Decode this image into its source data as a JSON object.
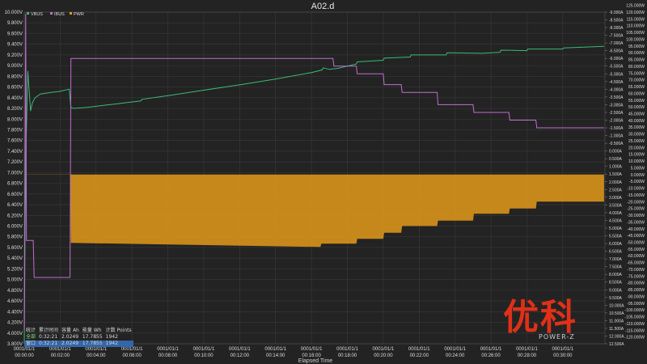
{
  "chart_data": {
    "type": "line",
    "title": "A02.d",
    "xlabel": "Elapsed Time",
    "x_ticks": [
      [
        "0001/01/1",
        "00:00:00"
      ],
      [
        "0001/01/1",
        "00:02:00"
      ],
      [
        "0001/01/1",
        "00:04:00"
      ],
      [
        "0001/01/1",
        "00:06:00"
      ],
      [
        "0001/01/1",
        "00:08:00"
      ],
      [
        "0001/01/1",
        "00:10:00"
      ],
      [
        "0001/01/1",
        "00:12:00"
      ],
      [
        "0001/01/1",
        "00:14:00"
      ],
      [
        "0001/01/1",
        "00:16:00"
      ],
      [
        "0001/01/1",
        "00:18:00"
      ],
      [
        "0001/01/1",
        "00:20:00"
      ],
      [
        "0001/01/1",
        "00:22:00"
      ],
      [
        "0001/01/1",
        "00:24:00"
      ],
      [
        "0001/01/1",
        "00:26:00"
      ],
      [
        "0001/01/1",
        "00:28:00"
      ],
      [
        "0001/01/1",
        "00:30:00"
      ]
    ],
    "xlim": [
      0,
      32.35
    ],
    "grid": true,
    "legend": "top-left",
    "axes": {
      "voltage": {
        "ylim": [
          3.8,
          10.0
        ],
        "ticks": [
          "3.800V",
          "4.000V",
          "4.200V",
          "4.400V",
          "4.600V",
          "4.800V",
          "5.000V",
          "5.200V",
          "5.400V",
          "5.600V",
          "5.800V",
          "6.000V",
          "6.200V",
          "6.400V",
          "6.600V",
          "6.800V",
          "7.000V",
          "7.200V",
          "7.400V",
          "7.600V",
          "7.800V",
          "8.000V",
          "8.200V",
          "8.400V",
          "8.600V",
          "8.800V",
          "9.000V",
          "9.200V",
          "9.400V",
          "9.600V",
          "9.800V",
          "10.000V"
        ]
      },
      "current": {
        "ylim": [
          12.5,
          -9.0
        ],
        "reversed": true,
        "ticks": [
          "-9.000A",
          "-8.500A",
          "-8.000A",
          "-7.500A",
          "-7.000A",
          "-6.500A",
          "-6.000A",
          "-5.500A",
          "-5.000A",
          "-4.500A",
          "-4.000A",
          "-3.500A",
          "-3.000A",
          "-2.500A",
          "-2.000A",
          "-1.500A",
          "-1.000A",
          "-0.500A",
          "0.000A",
          "0.500A",
          "1.000A",
          "1.500A",
          "2.000A",
          "2.500A",
          "3.000A",
          "3.500A",
          "4.000A",
          "4.500A",
          "5.000A",
          "5.500A",
          "6.000A",
          "6.500A",
          "7.000A",
          "7.500A",
          "8.000A",
          "8.500A",
          "9.000A",
          "9.500A",
          "10.000A",
          "10.500A",
          "11.000A",
          "11.500A",
          "12.000A",
          "12.500A"
        ]
      },
      "power": {
        "ylim": [
          -125,
          120
        ],
        "reversed": true,
        "ticks": [
          "-120.000W",
          "-115.000W",
          "-110.000W",
          "-105.000W",
          "-100.000W",
          "-95.000W",
          "-90.000W",
          "-85.000W",
          "-80.000W",
          "-75.000W",
          "-70.000W",
          "-65.000W",
          "-60.000W",
          "-55.000W",
          "-50.000W",
          "-45.000W",
          "-40.000W",
          "-35.000W",
          "-30.000W",
          "-25.000W",
          "-20.000W",
          "-15.000W",
          "-10.000W",
          "-5.000W",
          "0.000W",
          "5.000W",
          "10.000W",
          "15.000W",
          "20.000W",
          "25.000W",
          "30.000W",
          "35.000W",
          "40.000W",
          "45.000W",
          "50.000W",
          "55.000W",
          "60.000W",
          "65.000W",
          "70.000W",
          "75.000W",
          "80.000W",
          "85.000W",
          "90.000W",
          "95.000W",
          "100.000W",
          "105.000W",
          "110.000W",
          "115.000W",
          "120.000W",
          "125.000W"
        ]
      }
    },
    "series": [
      {
        "name": "VBUS",
        "axis": "voltage",
        "color": "#3cb878",
        "x": [
          0,
          0.05,
          0.1,
          0.15,
          0.2,
          0.35,
          0.45,
          0.6,
          0.9,
          1.5,
          2.0,
          2.5,
          2.6,
          2.75,
          3.5,
          5.0,
          6.5,
          6.55,
          8.0,
          10.0,
          12.0,
          14.0,
          16.0,
          16.6,
          16.65,
          17.0,
          17.5,
          18.5,
          18.55,
          20.0,
          20.05,
          21.5,
          21.55,
          23.5,
          23.55,
          25.5,
          26.5,
          26.55,
          28.0,
          28.05,
          30.0,
          30.05,
          32.3
        ],
        "y": [
          3.8,
          6.1,
          7.5,
          8.2,
          8.9,
          8.15,
          8.3,
          8.4,
          8.47,
          8.5,
          8.52,
          8.56,
          8.22,
          8.2,
          8.22,
          8.28,
          8.34,
          8.37,
          8.44,
          8.54,
          8.64,
          8.75,
          8.87,
          8.92,
          8.96,
          8.93,
          8.95,
          9.03,
          9.07,
          9.1,
          9.14,
          9.16,
          9.2,
          9.2,
          9.24,
          9.23,
          9.25,
          9.29,
          9.28,
          9.31,
          9.31,
          9.33,
          9.36
        ]
      },
      {
        "name": "IBUS",
        "axis": "current",
        "color": "#c06ed0",
        "x": [
          0,
          0.08,
          0.12,
          0.3,
          0.35,
          0.5,
          0.55,
          2.55,
          2.6,
          17.2,
          17.25,
          18.5,
          18.55,
          20.0,
          20.05,
          21.0,
          21.05,
          23.0,
          23.05,
          25.0,
          25.05,
          27.0,
          27.05,
          28.5,
          28.55,
          32.3
        ],
        "y": [
          11.6,
          -8.9,
          5.8,
          5.8,
          5.8,
          5.8,
          8.2,
          8.2,
          -6.0,
          -6.0,
          -5.5,
          -5.5,
          -5.0,
          -5.0,
          -4.3,
          -4.3,
          -3.8,
          -3.8,
          -3.0,
          -3.0,
          -2.5,
          -2.5,
          -2.0,
          -2.0,
          -1.5,
          -1.5
        ]
      },
      {
        "name": "PWR",
        "axis": "power",
        "color": "#e39a1a",
        "fill": true,
        "x": [
          0,
          2.55,
          2.6,
          16.5,
          16.55,
          18.5,
          18.55,
          20.0,
          20.05,
          21.0,
          21.05,
          23.0,
          23.05,
          25.0,
          25.05,
          27.0,
          27.05,
          28.5,
          28.55,
          32.3
        ],
        "y": [
          -0.1,
          -0.1,
          -50.5,
          -53.5,
          -51.0,
          -51.0,
          -47.5,
          -47.5,
          -43.0,
          -43.0,
          -38.0,
          -38.0,
          -34.0,
          -34.0,
          -29.0,
          -29.0,
          -25.0,
          -25.0,
          -20.0,
          -20.0
        ]
      }
    ]
  },
  "stats": {
    "headers": [
      "统计",
      "累计时间",
      "容量 Ah",
      "能量 Wh",
      "计数 Points"
    ],
    "rows": [
      {
        "label": "全部",
        "time": "0:32:21",
        "ah": "2.0249",
        "wh": "17.7855",
        "points": "1942"
      },
      {
        "label": "窗口",
        "time": "0:32:21",
        "ah": "2.0249",
        "wh": "17.7855",
        "points": "1942"
      }
    ]
  },
  "watermark": {
    "logo": "优科",
    "sub": "POWER-Z"
  },
  "colors": {
    "background": "#232323",
    "grid": "#3a3a3a",
    "text": "#dcdcdc"
  }
}
